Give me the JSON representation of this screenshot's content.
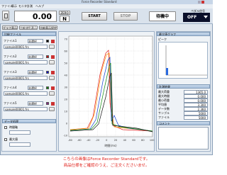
{
  "window": {
    "title": "Force Recorder Standard"
  },
  "menu": [
    "ファイル",
    "表示",
    "モニタ",
    "計測",
    "ヘルプ"
  ],
  "toolbar": {
    "display_value": "0.00",
    "unit": "N",
    "zero_label": "ZERO",
    "start_label": "START",
    "stop_label": "STOP",
    "status_label": "待機中",
    "toggle_label": "OFF",
    "toggle_caption": "ペダル信号"
  },
  "tabs": [
    "グラフ表示",
    "比較波形表示",
    "比較表示設定"
  ],
  "left_panel": {
    "title": "比較ファイル",
    "files": [
      {
        "label": "ファイル1",
        "state": "非選択",
        "color": "#000000",
        "path": "sample00001.frs"
      },
      {
        "label": "ファイル2",
        "state": "非選択",
        "color": "#cc1111",
        "path": "sample00001.frs"
      },
      {
        "label": "ファイル3",
        "state": "非選択",
        "color": "#1111cc",
        "path": "sample00001.frs"
      },
      {
        "label": "ファイル4",
        "state": "非選択",
        "color": "#118811",
        "path": "sample00001.frs"
      },
      {
        "label": "ファイル5",
        "state": "非選択",
        "color": "#882288",
        "path": "sample00001.frs"
      }
    ],
    "options_title": "データ処理",
    "options": [
      "時間軸",
      "最大値"
    ]
  },
  "graph": {
    "y_ticks": [
      "70",
      "60",
      "50",
      "40",
      "30",
      "20",
      "10",
      "0",
      "-10"
    ],
    "x_ticks": [
      "-80",
      "-60",
      "-40",
      "-20",
      "0",
      "20",
      "40",
      "60",
      "80",
      "100"
    ],
    "x_label": "時間(ms)",
    "y_label": "荷重(N)"
  },
  "right_panel": {
    "title": "最大値グラフ",
    "sub_title": "ピーク",
    "table_title": "計測結果",
    "rows": [
      {
        "name": "最大荷重",
        "value": "1365.0"
      },
      {
        "name": "最大時間",
        "value": "0.000"
      },
      {
        "name": "最小荷重",
        "value": "0.000"
      },
      {
        "name": "平均値",
        "value": "3.300"
      },
      {
        "name": "データ数",
        "value": "2.360"
      },
      {
        "name": "サンプル",
        "value": "5000"
      },
      {
        "name": "ファイル",
        "value": "5000"
      }
    ],
    "comment_title": "コメント"
  },
  "caption": {
    "line1": "こちらの画像はForce Recorder Standardです。",
    "line2": "商品仕様をご確認のうえ、ご注文くださいませ。"
  },
  "colors": {
    "accent": "#1f5fb0",
    "toggle_bg": "#0a0f2a",
    "caption": "#e0201a"
  }
}
